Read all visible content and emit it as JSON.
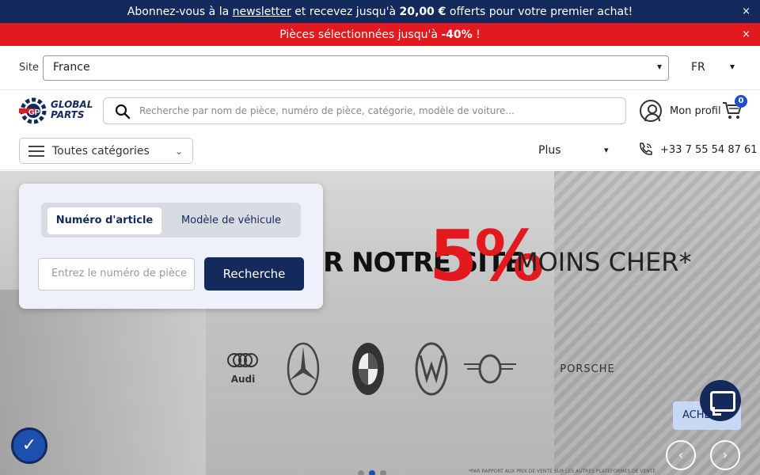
{
  "announcement": {
    "prefix": "Abonnez-vous à la",
    "link": "newsletter",
    "middle": "et recevez jusqu'à",
    "amount": "20,00 €",
    "suffix": "offerts pour votre premier achat!",
    "close_label": "×"
  },
  "promo": {
    "prefix": "Pièces sélectionnées jusqu'à",
    "discount": "-40%",
    "suffix": "!",
    "close_label": "×"
  },
  "site_selector": {
    "label": "Site",
    "value": "France",
    "language": "FR"
  },
  "header": {
    "logo_line1": "GLOBAL",
    "logo_line2": "PARTS",
    "search_placeholder": "Recherche par nom de pièce, numéro de pièce, catégorie, modèle de voiture...",
    "profile_label": "Mon profil",
    "cart_count": "0"
  },
  "nav": {
    "categories_label": "Toutes catégories",
    "more_label": "Plus",
    "phone": "+33 7 55 54 87 61"
  },
  "search_card": {
    "tabs": [
      "Numéro d'article",
      "Modèle de véhicule"
    ],
    "input_placeholder": "Entrez le numéro de pièce",
    "button_label": "Recherche"
  },
  "hero": {
    "headline": "R NOTRE SITE",
    "percent": "5%",
    "tagline": "MOINS CHER*",
    "brands": [
      "Audi",
      "Mercedes-Benz",
      "BMW",
      "Volkswagen",
      "MINI",
      "PORSCHE"
    ],
    "audi_label": "Audi",
    "porsche_label": "PORSCHE",
    "footnote": "*PAR RAPPORT AUX PRIX DE VENTE SUR LES AUTRES PLATEFORMES DE VENTE"
  },
  "widgets": {
    "acheter_label": "ACHETER",
    "prev_arrow": "‹",
    "next_arrow": "›"
  }
}
